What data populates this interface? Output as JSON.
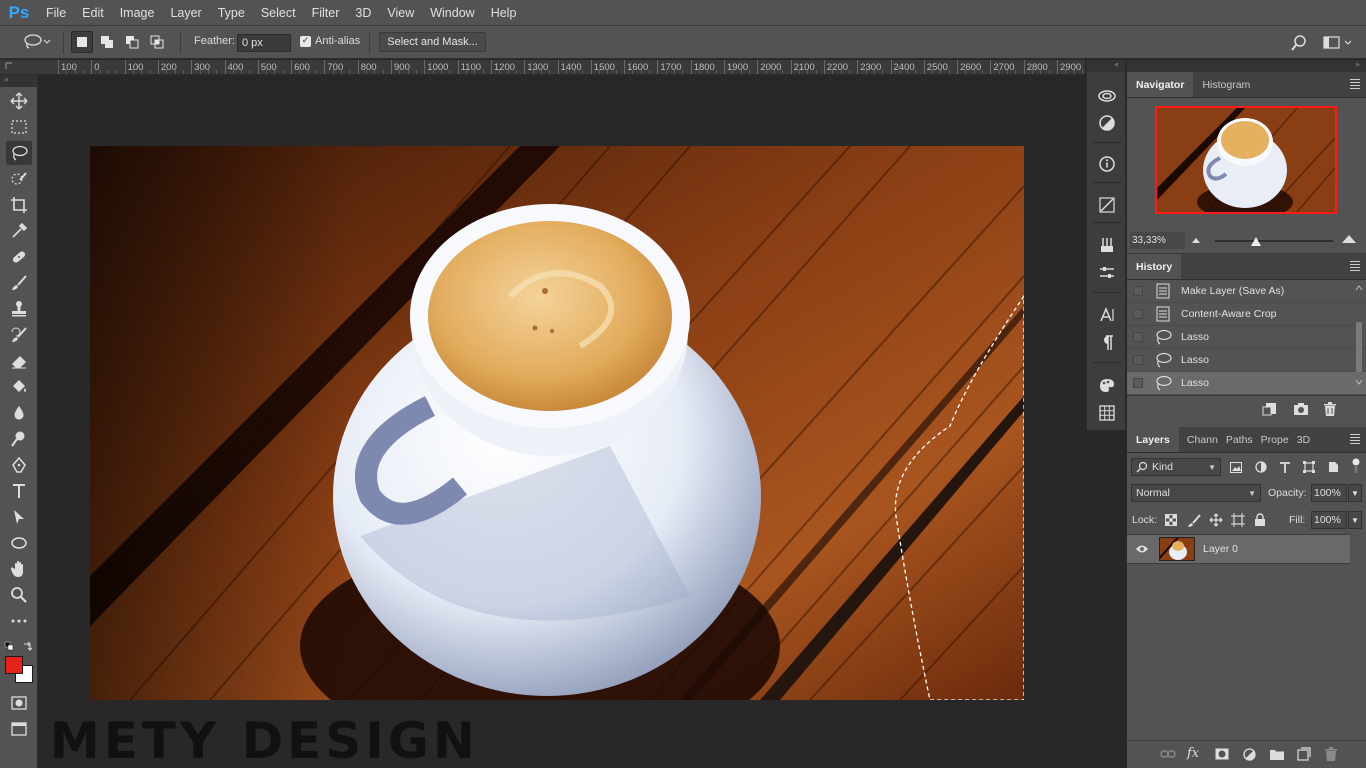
{
  "app": {
    "logo": "Ps"
  },
  "menu": [
    "File",
    "Edit",
    "Image",
    "Layer",
    "Type",
    "Select",
    "Filter",
    "3D",
    "View",
    "Window",
    "Help"
  ],
  "options": {
    "feather_label": "Feather:",
    "feather_value": "0 px",
    "antialias_label": "Anti-alias",
    "antialias_checked": true,
    "select_mask_label": "Select and Mask..."
  },
  "ruler": {
    "labels": [
      "100",
      "0",
      "100",
      "200",
      "300",
      "400",
      "500",
      "600",
      "700",
      "800",
      "900",
      "1000",
      "1100",
      "1200",
      "1300",
      "1400",
      "1500",
      "1600",
      "1700",
      "1800",
      "1900",
      "2000",
      "2100",
      "2200",
      "2300",
      "2400",
      "2500",
      "2600",
      "2700",
      "2800",
      "2900"
    ]
  },
  "tools": [
    "move-tool",
    "marquee-tool",
    "lasso-tool",
    "quick-selection-tool",
    "crop-tool",
    "eyedropper-tool",
    "healing-brush-tool",
    "brush-tool",
    "clone-stamp-tool",
    "history-brush-tool",
    "eraser-tool",
    "paint-bucket-tool",
    "blur-tool",
    "dodge-tool",
    "pen-tool",
    "type-tool",
    "path-selection-tool",
    "ellipse-tool",
    "hand-tool",
    "zoom-tool",
    "more-tools"
  ],
  "colors": {
    "foreground": "#e8211a",
    "background": "#ffffff",
    "selection_border": "#ff1a1a",
    "ps_blue": "#31a8ff"
  },
  "canvas": {
    "watermark": "METY DESIGN"
  },
  "navigator": {
    "tab_active": "Navigator",
    "tab_other": "Histogram",
    "zoom": "33,33%"
  },
  "history": {
    "title": "History",
    "items": [
      {
        "label": "Make Layer (Save As)",
        "icon": "document-icon",
        "selected": false
      },
      {
        "label": "Content-Aware Crop",
        "icon": "document-icon",
        "selected": false
      },
      {
        "label": "Lasso",
        "icon": "lasso-icon",
        "selected": false
      },
      {
        "label": "Lasso",
        "icon": "lasso-icon",
        "selected": false
      },
      {
        "label": "Lasso",
        "icon": "lasso-icon",
        "selected": true
      }
    ]
  },
  "layers": {
    "tabs": [
      "Layers",
      "Chann",
      "Paths",
      "Prope",
      "3D"
    ],
    "filter_kind": "Kind",
    "blend_mode": "Normal",
    "opacity_label": "Opacity:",
    "opacity_value": "100%",
    "lock_label": "Lock:",
    "fill_label": "Fill:",
    "fill_value": "100%",
    "items": [
      {
        "name": "Layer 0",
        "visible": true
      }
    ],
    "footer_fx": "fx"
  }
}
